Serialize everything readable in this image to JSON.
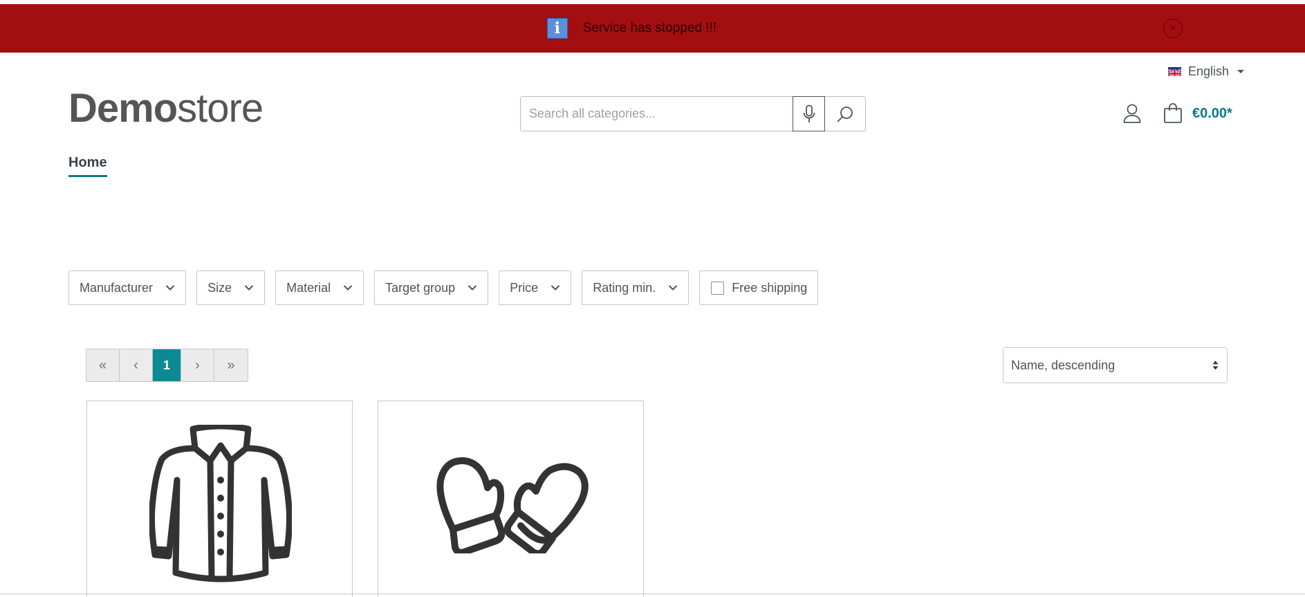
{
  "alert": {
    "message": "Service has stopped !!!",
    "info_icon": "info-icon",
    "close_icon": "close-icon",
    "close_glyph": "×",
    "info_glyph": "i"
  },
  "language": {
    "selected": "English",
    "flag_icon": "uk-flag-icon"
  },
  "logo": {
    "bold": "Demo",
    "light": "store"
  },
  "search": {
    "placeholder": "Search all categories...",
    "value": ""
  },
  "cart": {
    "total": "€0.00*"
  },
  "nav": {
    "items": [
      {
        "label": "Home",
        "active": true
      }
    ]
  },
  "filters": {
    "items": [
      {
        "label": "Manufacturer"
      },
      {
        "label": "Size"
      },
      {
        "label": "Material"
      },
      {
        "label": "Target group"
      },
      {
        "label": "Price"
      },
      {
        "label": "Rating min."
      }
    ],
    "free_shipping": {
      "label": "Free shipping",
      "checked": false
    }
  },
  "pagination": {
    "first": "«",
    "prev": "‹",
    "current": "1",
    "next": "›",
    "last": "»"
  },
  "sort": {
    "selected": "Name, descending"
  },
  "products": [
    {
      "icon": "jacket-icon"
    },
    {
      "icon": "mittens-icon"
    }
  ],
  "colors": {
    "alert_bg": "#a30e11",
    "accent": "#0b8a93",
    "price": "#0b7a82"
  }
}
